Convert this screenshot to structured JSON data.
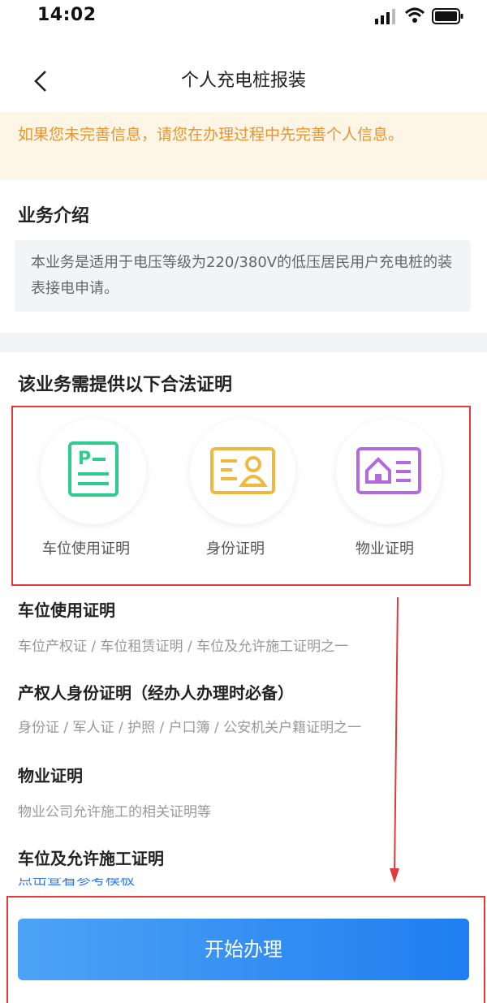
{
  "status": {
    "time": "14:02"
  },
  "nav": {
    "title": "个人充电桩报装"
  },
  "notice": {
    "text": "如果您未完善信息，请您在办理过程中先完善个人信息。"
  },
  "intro": {
    "title": "业务介绍",
    "text": "本业务是适用于电压等级为220/380V的低压居民用户充电桩的装表接电申请。"
  },
  "docs": {
    "title": "该业务需提供以下合法证明",
    "items": [
      {
        "label": "车位使用证明",
        "icon": "parking-doc-icon",
        "color": "#2ecc8f"
      },
      {
        "label": "身份证明",
        "icon": "id-card-icon",
        "color": "#f0b840"
      },
      {
        "label": "物业证明",
        "icon": "property-doc-icon",
        "color": "#b469e0"
      }
    ]
  },
  "details": [
    {
      "title": "车位使用证明",
      "desc": "车位产权证 / 车位租赁证明 / 车位及允许施工证明之一"
    },
    {
      "title": "产权人身份证明（经办人办理时必备）",
      "desc": "身份证 / 军人证 / 护照 / 户口簿 / 公安机关户籍证明之一"
    },
    {
      "title": "物业证明",
      "desc": "物业公司允许施工的相关证明等"
    },
    {
      "title": "车位及允许施工证明"
    }
  ],
  "partial_link": "点击查看参考模板",
  "button": {
    "label": "开始办理"
  },
  "colors": {
    "accent": "#1f7ef0",
    "notice": "#e89531",
    "highlight": "#e23a3a"
  }
}
